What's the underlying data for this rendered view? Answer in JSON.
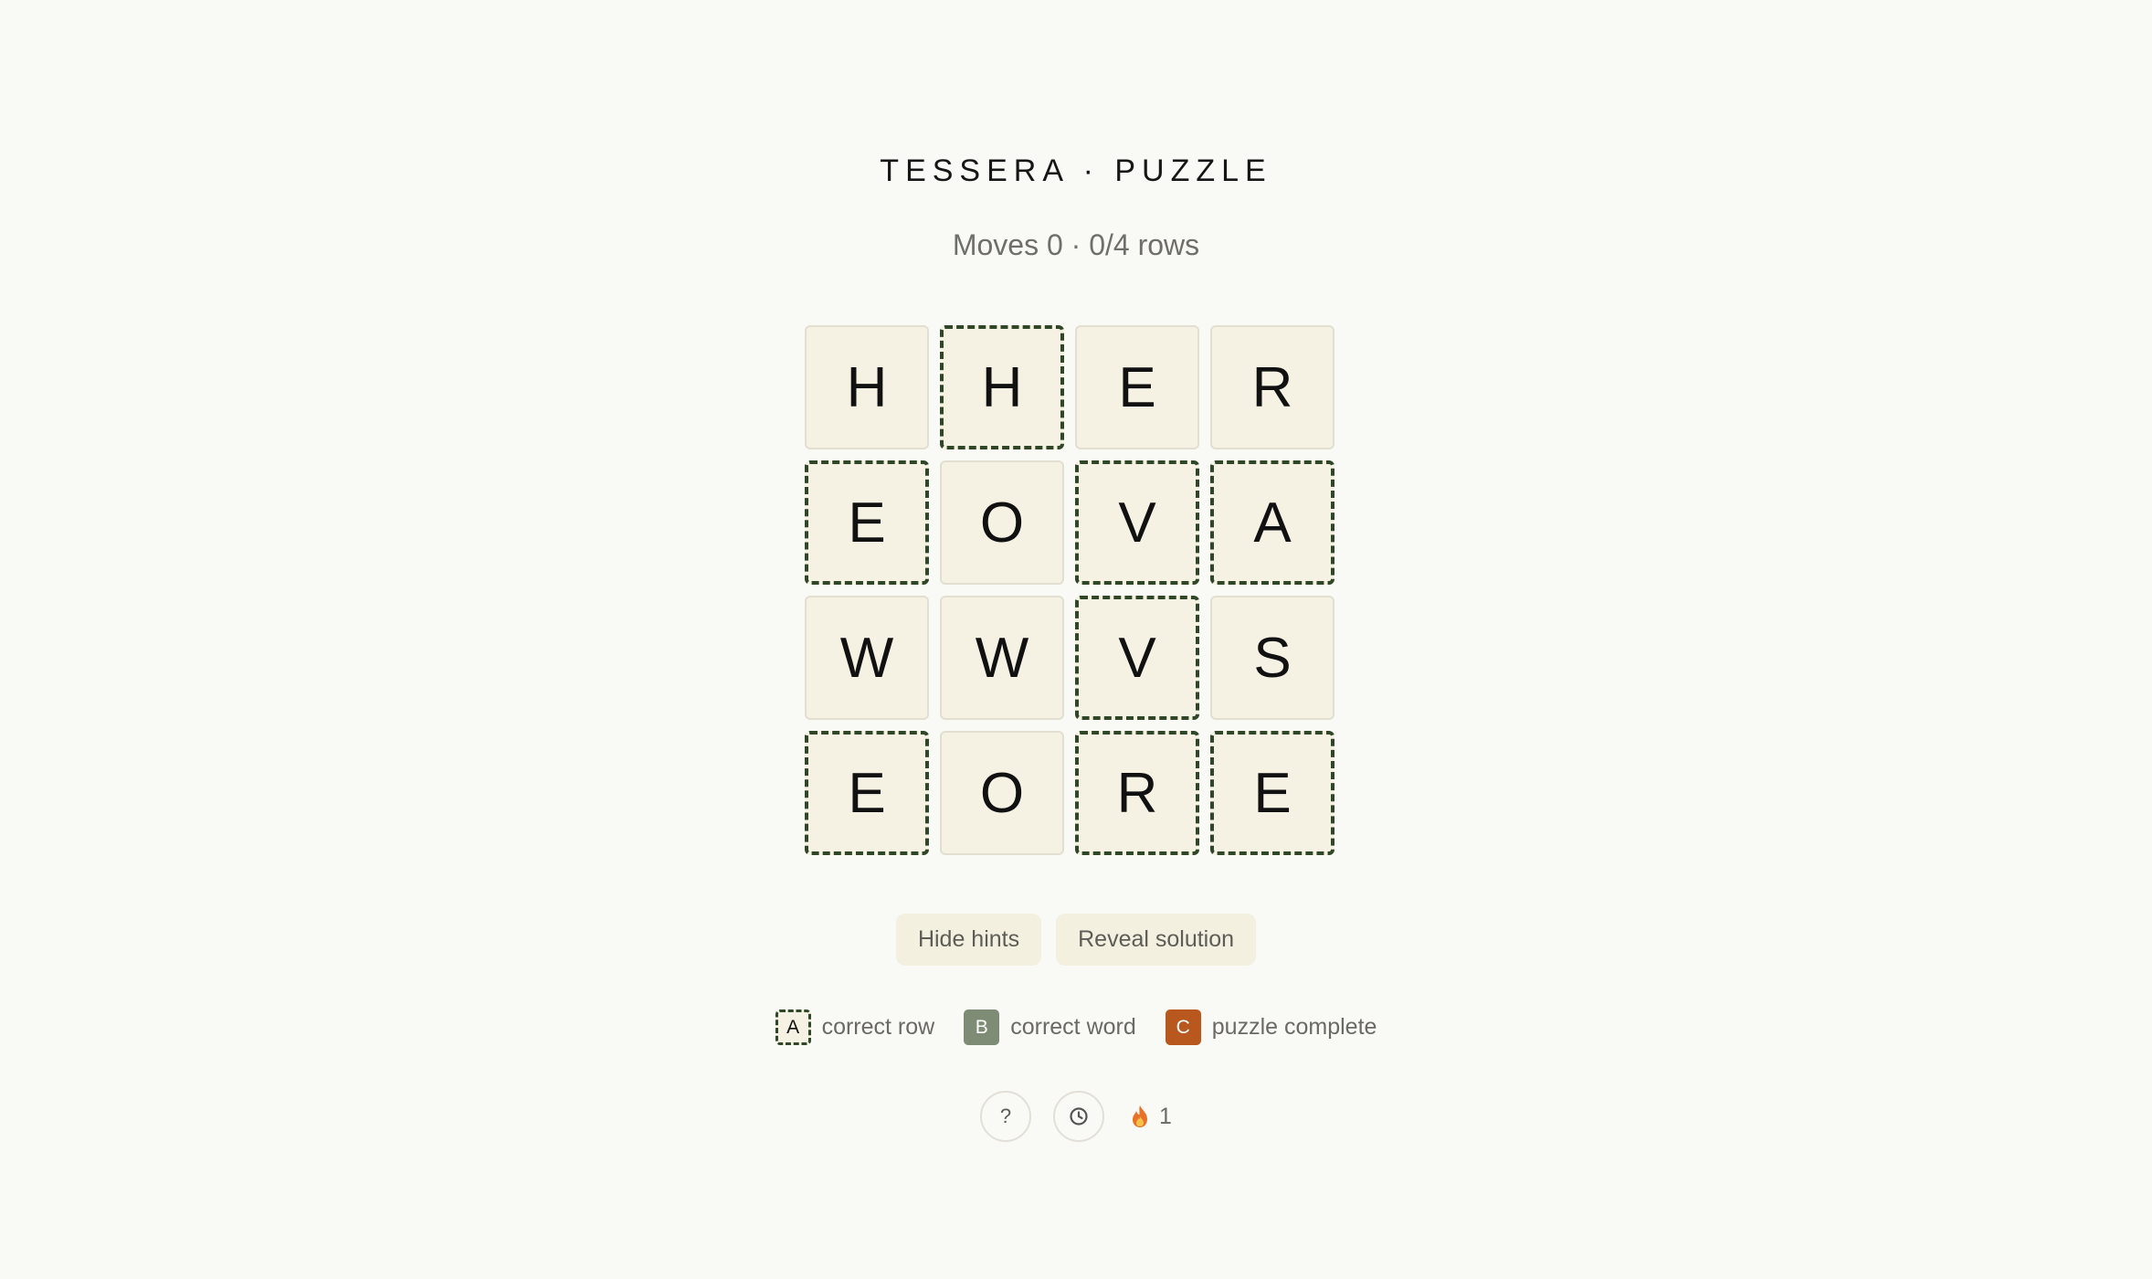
{
  "header": {
    "title": "TESSERA · PUZZLE",
    "status": "Moves 0 · 0/4 rows"
  },
  "board": {
    "rows": [
      [
        {
          "letter": "H",
          "hint": false
        },
        {
          "letter": "H",
          "hint": true
        },
        {
          "letter": "E",
          "hint": false
        },
        {
          "letter": "R",
          "hint": false
        }
      ],
      [
        {
          "letter": "E",
          "hint": true
        },
        {
          "letter": "O",
          "hint": false
        },
        {
          "letter": "V",
          "hint": true
        },
        {
          "letter": "A",
          "hint": true
        }
      ],
      [
        {
          "letter": "W",
          "hint": false
        },
        {
          "letter": "W",
          "hint": false
        },
        {
          "letter": "V",
          "hint": true
        },
        {
          "letter": "S",
          "hint": false
        }
      ],
      [
        {
          "letter": "E",
          "hint": true
        },
        {
          "letter": "O",
          "hint": false
        },
        {
          "letter": "R",
          "hint": true
        },
        {
          "letter": "E",
          "hint": true
        }
      ]
    ]
  },
  "buttons": {
    "hide_hints": "Hide hints",
    "reveal_solution": "Reveal solution"
  },
  "legend": {
    "row": {
      "swatch": "A",
      "label": "correct row"
    },
    "word": {
      "swatch": "B",
      "label": "correct word"
    },
    "done": {
      "swatch": "C",
      "label": "puzzle complete"
    }
  },
  "footer": {
    "help_label": "?",
    "history_icon": "clock-icon",
    "streak_icon": "flame-icon",
    "streak_count": "1"
  },
  "colors": {
    "background": "#f9f9f6",
    "tile": "#f5f2e4",
    "hint_border": "#2f4726",
    "correct_word": "#7f8c75",
    "puzzle_complete": "#b8581e"
  }
}
